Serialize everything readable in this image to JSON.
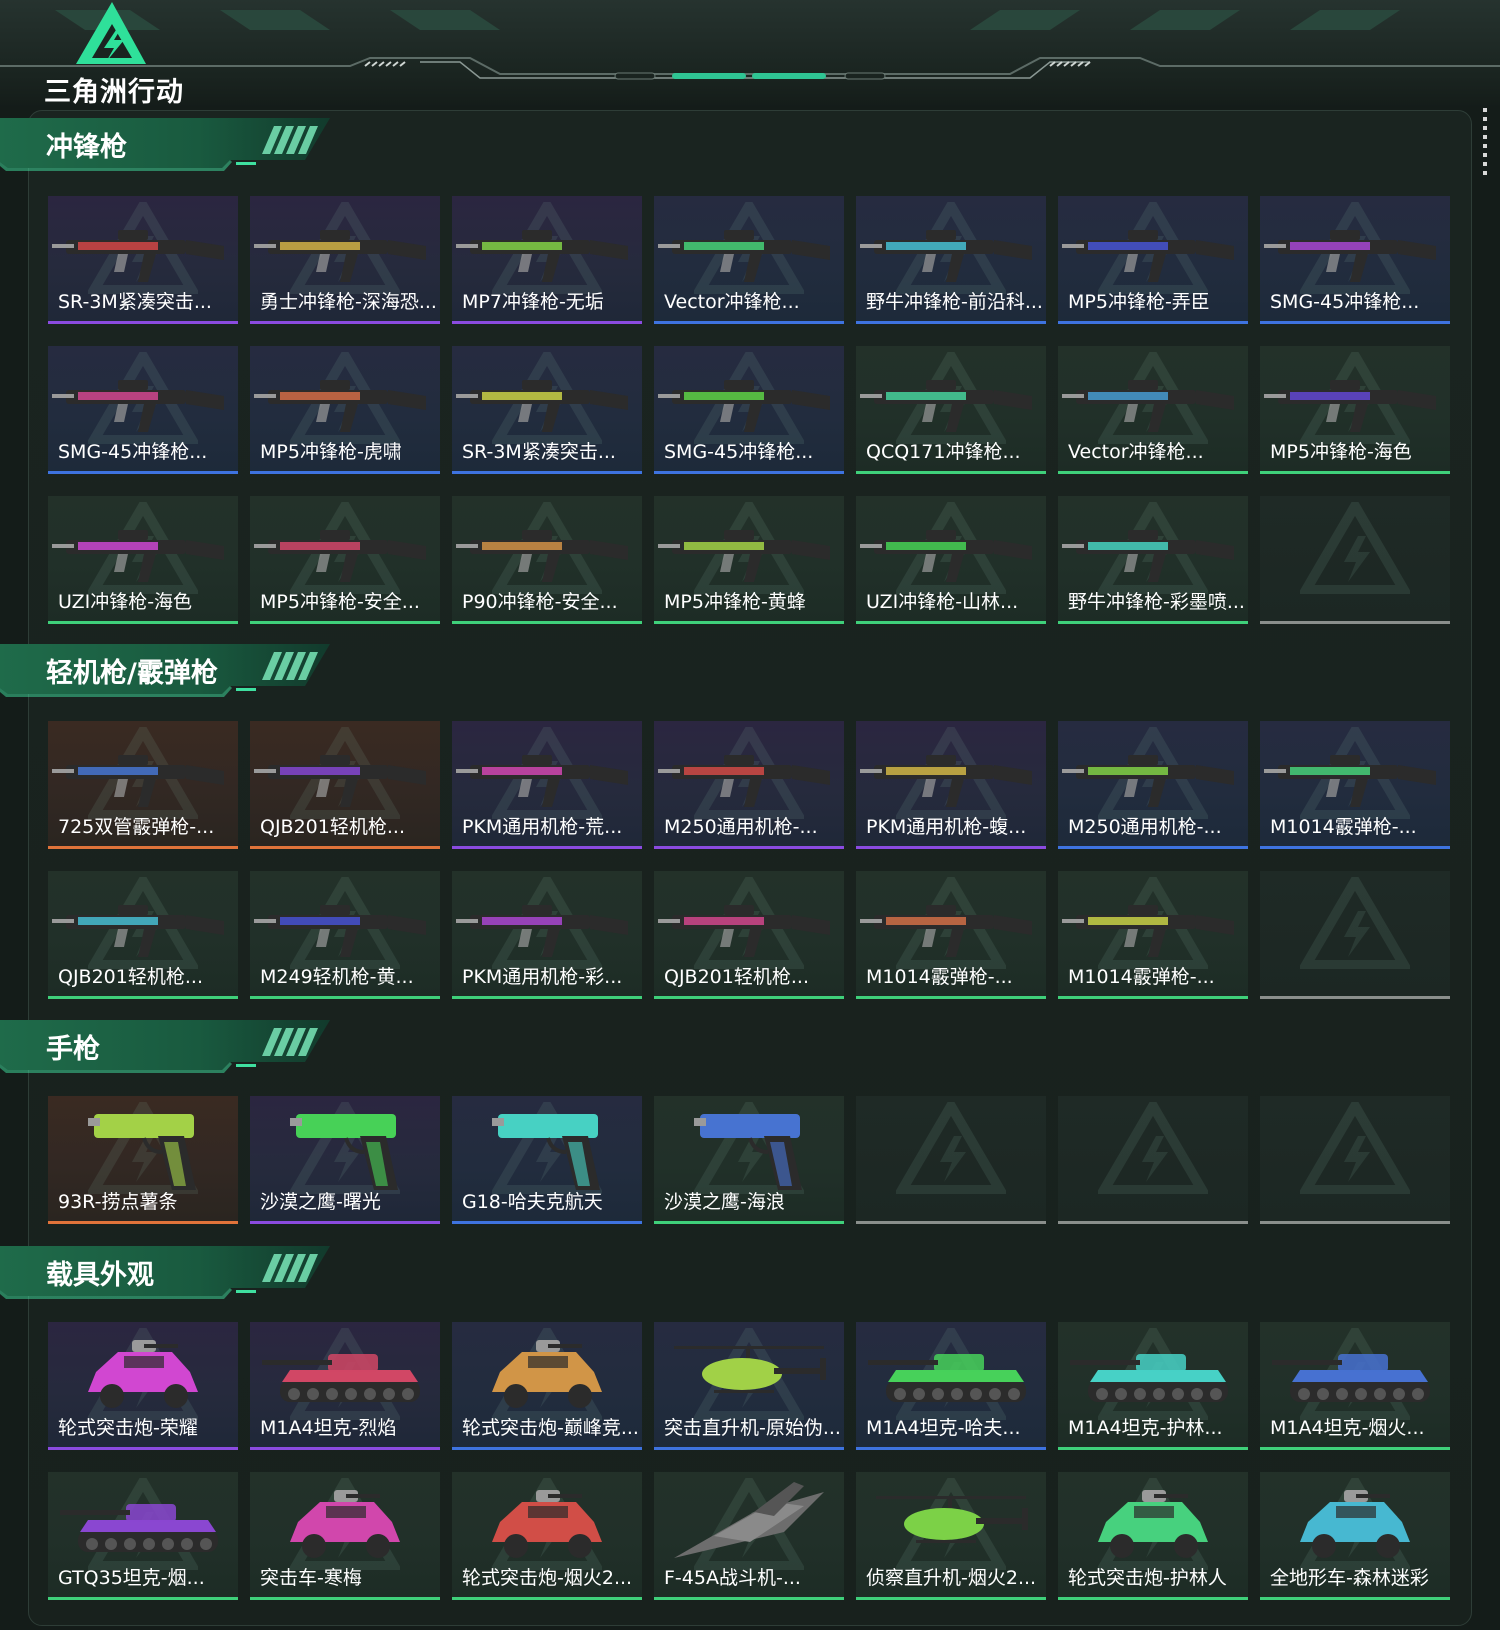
{
  "brand": {
    "logo_text": "三角洲行动",
    "accent": "#3fe0a0"
  },
  "rarity_colors": {
    "purple": "#8b4be0",
    "blue": "#3e73e0",
    "green": "#3fd07a",
    "orange": "#e0733a",
    "empty": "#8a8f8c"
  },
  "sections": [
    {
      "title": "冲锋枪",
      "items": [
        {
          "label": "SR-3M紧凑突击...",
          "rarity": "purple",
          "kind": "gun"
        },
        {
          "label": "勇士冲锋枪-深海恐...",
          "rarity": "purple",
          "kind": "gun"
        },
        {
          "label": "MP7冲锋枪-无垢",
          "rarity": "purple",
          "kind": "gun"
        },
        {
          "label": "Vector冲锋枪...",
          "rarity": "blue",
          "kind": "gun"
        },
        {
          "label": "野牛冲锋枪-前沿科...",
          "rarity": "blue",
          "kind": "gun"
        },
        {
          "label": "MP5冲锋枪-弄臣",
          "rarity": "blue",
          "kind": "gun"
        },
        {
          "label": "SMG-45冲锋枪...",
          "rarity": "blue",
          "kind": "gun"
        },
        {
          "label": "SMG-45冲锋枪...",
          "rarity": "blue",
          "kind": "gun"
        },
        {
          "label": "MP5冲锋枪-虎啸",
          "rarity": "blue",
          "kind": "gun"
        },
        {
          "label": "SR-3M紧凑突击...",
          "rarity": "blue",
          "kind": "gun"
        },
        {
          "label": "SMG-45冲锋枪...",
          "rarity": "blue",
          "kind": "gun"
        },
        {
          "label": "QCQ171冲锋枪...",
          "rarity": "green",
          "kind": "gun"
        },
        {
          "label": "Vector冲锋枪...",
          "rarity": "green",
          "kind": "gun"
        },
        {
          "label": "MP5冲锋枪-海色",
          "rarity": "green",
          "kind": "gun"
        },
        {
          "label": "UZI冲锋枪-海色",
          "rarity": "green",
          "kind": "gun"
        },
        {
          "label": "MP5冲锋枪-安全...",
          "rarity": "green",
          "kind": "gun"
        },
        {
          "label": "P90冲锋枪-安全...",
          "rarity": "green",
          "kind": "gun"
        },
        {
          "label": "MP5冲锋枪-黄蜂",
          "rarity": "green",
          "kind": "gun"
        },
        {
          "label": "UZI冲锋枪-山林...",
          "rarity": "green",
          "kind": "gun"
        },
        {
          "label": "野牛冲锋枪-彩墨喷...",
          "rarity": "green",
          "kind": "gun"
        },
        {
          "label": "",
          "rarity": "empty",
          "kind": "empty"
        }
      ]
    },
    {
      "title": "轻机枪/霰弹枪",
      "items": [
        {
          "label": "725双管霰弹枪-...",
          "rarity": "orange",
          "kind": "gun"
        },
        {
          "label": "QJB201轻机枪...",
          "rarity": "orange",
          "kind": "gun"
        },
        {
          "label": "PKM通用机枪-荒...",
          "rarity": "purple",
          "kind": "gun"
        },
        {
          "label": "M250通用机枪-...",
          "rarity": "purple",
          "kind": "gun"
        },
        {
          "label": "PKM通用机枪-蝮...",
          "rarity": "purple",
          "kind": "gun"
        },
        {
          "label": "M250通用机枪-...",
          "rarity": "blue",
          "kind": "gun"
        },
        {
          "label": "M1014霰弹枪-...",
          "rarity": "blue",
          "kind": "gun"
        },
        {
          "label": "QJB201轻机枪...",
          "rarity": "green",
          "kind": "gun"
        },
        {
          "label": "M249轻机枪-黄...",
          "rarity": "green",
          "kind": "gun"
        },
        {
          "label": "PKM通用机枪-彩...",
          "rarity": "green",
          "kind": "gun"
        },
        {
          "label": "QJB201轻机枪...",
          "rarity": "green",
          "kind": "gun"
        },
        {
          "label": "M1014霰弹枪-...",
          "rarity": "green",
          "kind": "gun"
        },
        {
          "label": "M1014霰弹枪-...",
          "rarity": "green",
          "kind": "gun"
        },
        {
          "label": "",
          "rarity": "empty",
          "kind": "empty"
        }
      ]
    },
    {
      "title": "手枪",
      "items": [
        {
          "label": "93R-捞点薯条",
          "rarity": "orange",
          "kind": "pistol"
        },
        {
          "label": "沙漠之鹰-曙光",
          "rarity": "purple",
          "kind": "pistol"
        },
        {
          "label": "G18-哈夫克航天",
          "rarity": "blue",
          "kind": "pistol"
        },
        {
          "label": "沙漠之鹰-海浪",
          "rarity": "green",
          "kind": "pistol"
        },
        {
          "label": "",
          "rarity": "empty",
          "kind": "empty"
        },
        {
          "label": "",
          "rarity": "empty",
          "kind": "empty"
        },
        {
          "label": "",
          "rarity": "empty",
          "kind": "empty"
        }
      ]
    },
    {
      "title": "载具外观",
      "items": [
        {
          "label": "轮式突击炮-荣耀",
          "rarity": "purple",
          "kind": "car"
        },
        {
          "label": "M1A4坦克-烈焰",
          "rarity": "purple",
          "kind": "tank"
        },
        {
          "label": "轮式突击炮-巅峰竞...",
          "rarity": "blue",
          "kind": "car"
        },
        {
          "label": "突击直升机-原始伪...",
          "rarity": "blue",
          "kind": "heli"
        },
        {
          "label": "M1A4坦克-哈夫...",
          "rarity": "blue",
          "kind": "tank"
        },
        {
          "label": "M1A4坦克-护林...",
          "rarity": "green",
          "kind": "tank"
        },
        {
          "label": "M1A4坦克-烟火...",
          "rarity": "green",
          "kind": "tank"
        },
        {
          "label": "GTQ35坦克-烟...",
          "rarity": "green",
          "kind": "tank"
        },
        {
          "label": "突击车-寒梅",
          "rarity": "green",
          "kind": "car"
        },
        {
          "label": "轮式突击炮-烟火2...",
          "rarity": "green",
          "kind": "car"
        },
        {
          "label": "F-45A战斗机-...",
          "rarity": "green",
          "kind": "jet"
        },
        {
          "label": "侦察直升机-烟火2...",
          "rarity": "green",
          "kind": "heli"
        },
        {
          "label": "轮式突击炮-护林人",
          "rarity": "green",
          "kind": "car"
        },
        {
          "label": "全地形车-森林迷彩",
          "rarity": "green",
          "kind": "car"
        }
      ]
    }
  ]
}
